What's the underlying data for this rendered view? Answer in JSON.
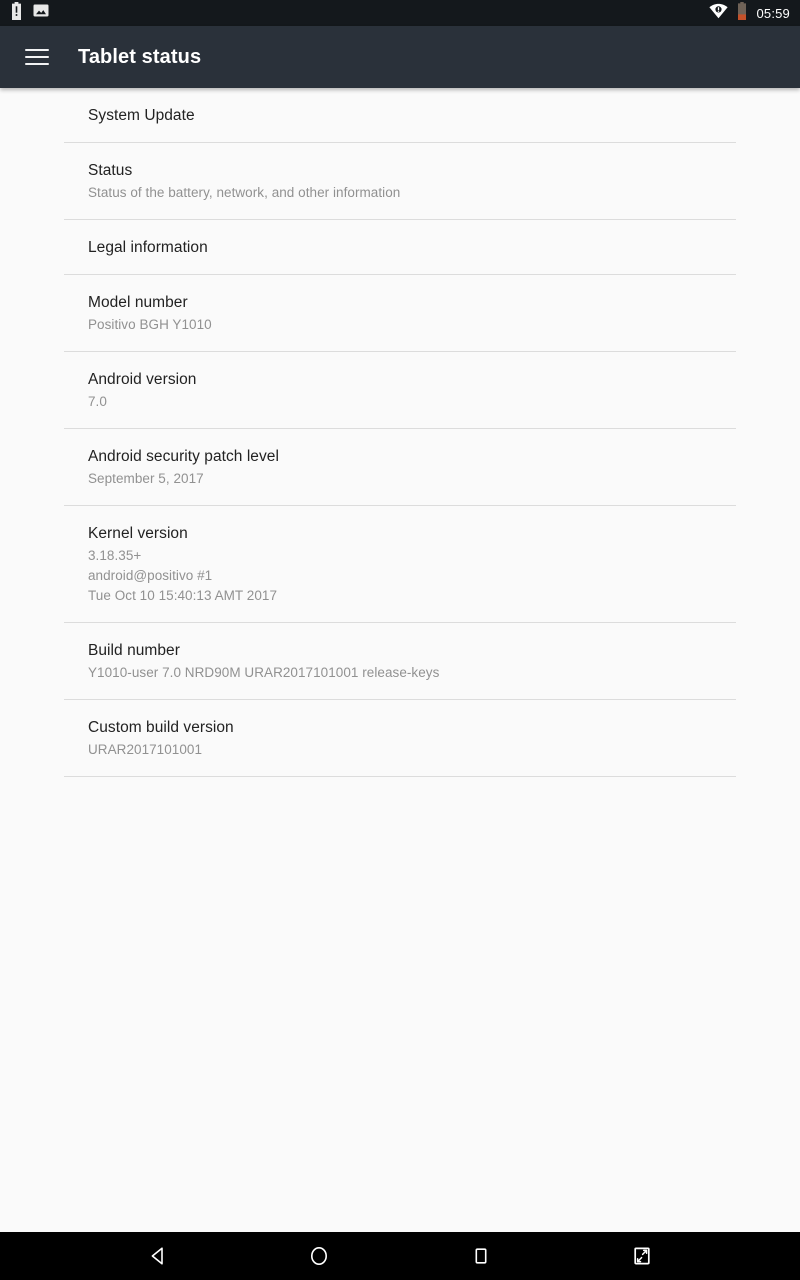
{
  "status_bar": {
    "time": "05:59",
    "left_icons": [
      {
        "name": "battery-alert-icon",
        "label": "Battery alert"
      },
      {
        "name": "screenshot-notification-icon",
        "label": "Screenshot captured"
      }
    ],
    "right_icons": [
      {
        "name": "wifi-no-internet-icon",
        "label": "Wi-Fi, no internet"
      },
      {
        "name": "battery-low-icon",
        "label": "Battery low"
      }
    ],
    "colors": {
      "background": "#14181c",
      "battery_low": "#c4512a",
      "icon": "#ffffff"
    }
  },
  "app_bar": {
    "title": "Tablet status",
    "menu_icon": "hamburger-menu-icon",
    "background": "#2a313a",
    "title_color": "#ffffff"
  },
  "list": {
    "items": [
      {
        "title": "System Update",
        "subtitle": []
      },
      {
        "title": "Status",
        "subtitle": [
          "Status of the battery, network, and other information"
        ]
      },
      {
        "title": "Legal information",
        "subtitle": []
      },
      {
        "title": "Model number",
        "subtitle": [
          "Positivo BGH Y1010"
        ]
      },
      {
        "title": "Android version",
        "subtitle": [
          "7.0"
        ]
      },
      {
        "title": "Android security patch level",
        "subtitle": [
          "September 5, 2017"
        ]
      },
      {
        "title": "Kernel version",
        "subtitle": [
          "3.18.35+",
          "android@positivo #1",
          "Tue Oct 10 15:40:13 AMT 2017"
        ]
      },
      {
        "title": "Build number",
        "subtitle": [
          "Y1010-user 7.0 NRD90M URAR2017101001 release-keys"
        ]
      },
      {
        "title": "Custom build version",
        "subtitle": [
          "URAR2017101001"
        ]
      }
    ],
    "colors": {
      "background": "#fafafa",
      "title": "#222222",
      "subtitle": "#919191",
      "divider": "#dcdcdc"
    }
  },
  "nav_bar": {
    "background": "#000000",
    "buttons": [
      {
        "name": "back-button",
        "icon": "back-triangle-icon",
        "label": "Back"
      },
      {
        "name": "home-button",
        "icon": "home-circle-icon",
        "label": "Home"
      },
      {
        "name": "recents-button",
        "icon": "recents-square-icon",
        "label": "Recents"
      },
      {
        "name": "screenshot-button",
        "icon": "screenshot-icon",
        "label": "Screenshot"
      }
    ]
  }
}
